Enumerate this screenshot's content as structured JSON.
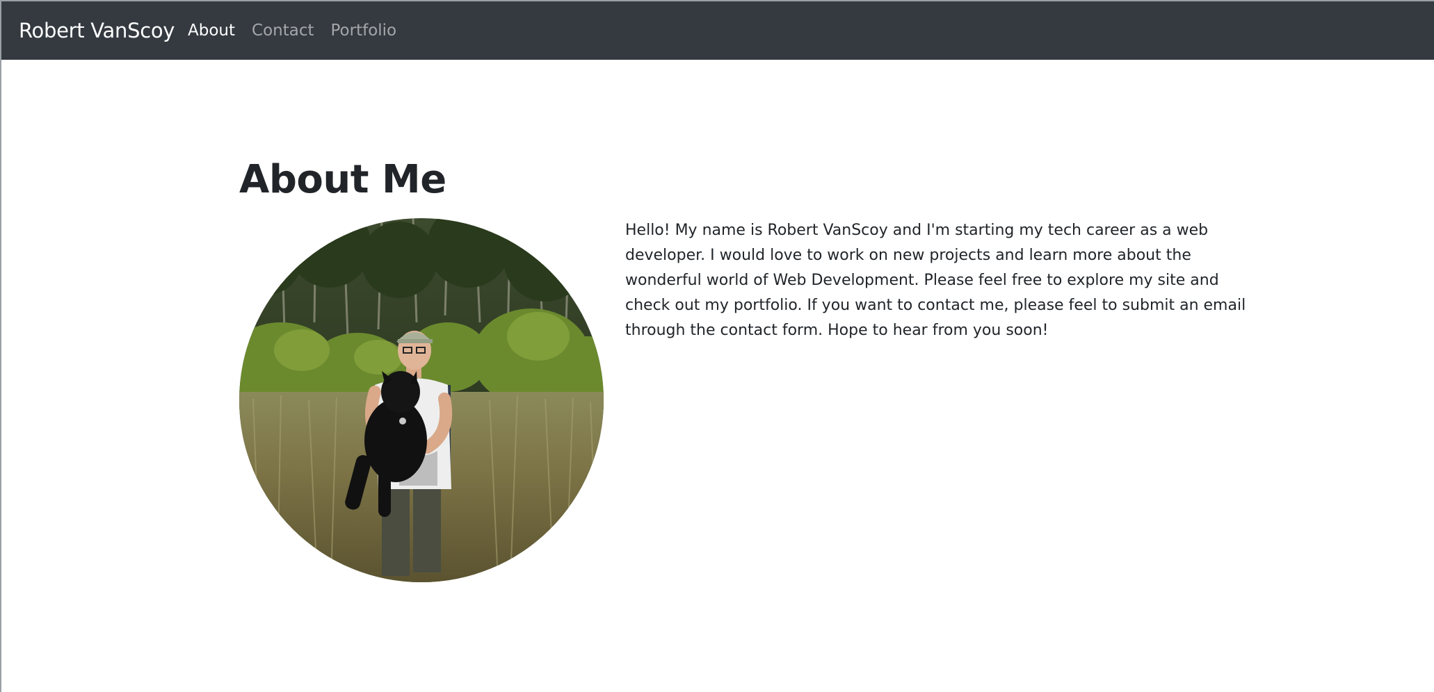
{
  "navbar": {
    "brand": "Robert VanScoy",
    "links": [
      {
        "label": "About",
        "active": true
      },
      {
        "label": "Contact",
        "active": false
      },
      {
        "label": "Portfolio",
        "active": false
      }
    ],
    "background": "#343a40"
  },
  "main": {
    "title": "About Me",
    "photo": {
      "alt": "photo-of-man-holding-black-dog-in-tall-grass"
    },
    "bio": "Hello! My name is Robert VanScoy and I'm starting my tech career as a web developer. I would love to work on new projects and learn more about the wonderful world of Web Development. Please feel free to explore my site and check out my portfolio. If you want to contact me, please feel to submit an email through the contact form. Hope to hear from you soon!"
  }
}
